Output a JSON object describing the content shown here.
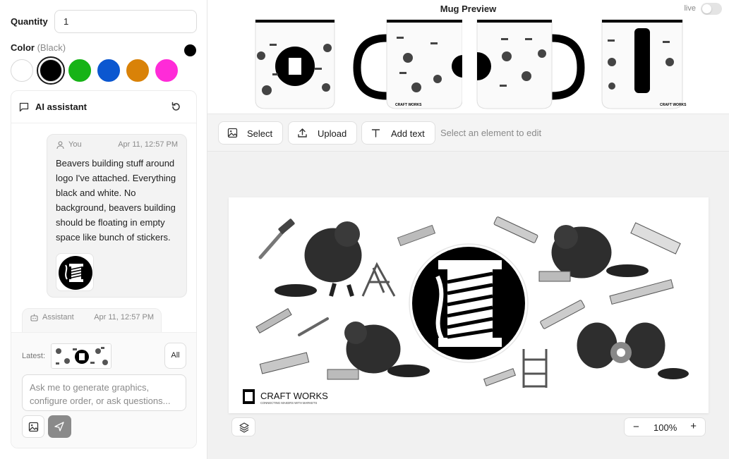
{
  "order": {
    "quantity_label": "Quantity",
    "quantity_value": "1",
    "color_label": "Color",
    "color_selected": "(Black)",
    "swatches": [
      "#ffffff",
      "#000000",
      "#17b317",
      "#0b57d0",
      "#d98208",
      "#ff2bd8"
    ],
    "selected_swatch": "#000000"
  },
  "assistant": {
    "title": "AI assistant",
    "messages": [
      {
        "author": "You",
        "time": "Apr 11, 12:57 PM",
        "text": "Beavers building stuff around logo I've attached. Everything black and white. No background, beavers building should be floating in empty space like bunch of stickers."
      },
      {
        "author": "Assistant",
        "time": "Apr 11, 12:57 PM"
      }
    ],
    "latest_label": "Latest:",
    "all_label": "All",
    "prompt_placeholder": "Ask me to generate graphics, configure order, or ask questions..."
  },
  "preview": {
    "title": "Mug Preview",
    "live_label": "live",
    "live_on": false
  },
  "toolbar": {
    "select_label": "Select",
    "upload_label": "Upload",
    "add_text_label": "Add text",
    "hint": "Select an element to edit"
  },
  "artwork": {
    "brand_name": "CRAFT WORKS",
    "brand_tagline": "CONNECTING MAKERS WITH MARKETS"
  },
  "zoom": {
    "minus": "−",
    "value": "100%",
    "plus": "+"
  }
}
